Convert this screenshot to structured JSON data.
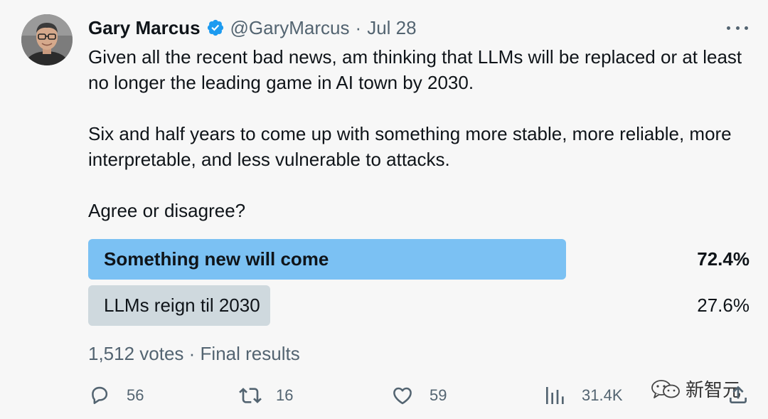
{
  "tweet": {
    "author_name": "Gary Marcus",
    "handle": "@GaryMarcus",
    "separator": "·",
    "date": "Jul 28",
    "paragraphs": [
      "Given all the recent bad news, am thinking that LLMs will be replaced or at least no longer the leading game in AI town by 2030.",
      "Six and half years to come up with something more stable, more reliable, more interpretable, and less vulnerable to attacks.",
      "Agree or disagree?"
    ]
  },
  "poll": {
    "options": [
      {
        "label": "Something new will come",
        "percent_text": "72.4%",
        "fraction": 0.724,
        "winner": true
      },
      {
        "label": "LLMs reign til 2030",
        "percent_text": "27.6%",
        "fraction": 0.276,
        "winner": false
      }
    ],
    "meta": "1,512 votes · Final results"
  },
  "actions": {
    "replies": "56",
    "retweets": "16",
    "likes": "59",
    "views": "31.4K"
  },
  "watermark": {
    "text": "新智元"
  },
  "colors": {
    "winner_bar": "#7bc1f3",
    "loser_bar": "#cfd9de",
    "verified": "#1d9bf0",
    "secondary_text": "#536471"
  },
  "icons": {
    "avatar": "avatar-photo",
    "verified": "verified-badge-icon",
    "more": "more-horizontal-icon",
    "reply": "reply-icon",
    "retweet": "retweet-icon",
    "like": "heart-icon",
    "views": "views-bar-chart-icon",
    "share": "share-icon",
    "watermark": "wechat-icon"
  }
}
